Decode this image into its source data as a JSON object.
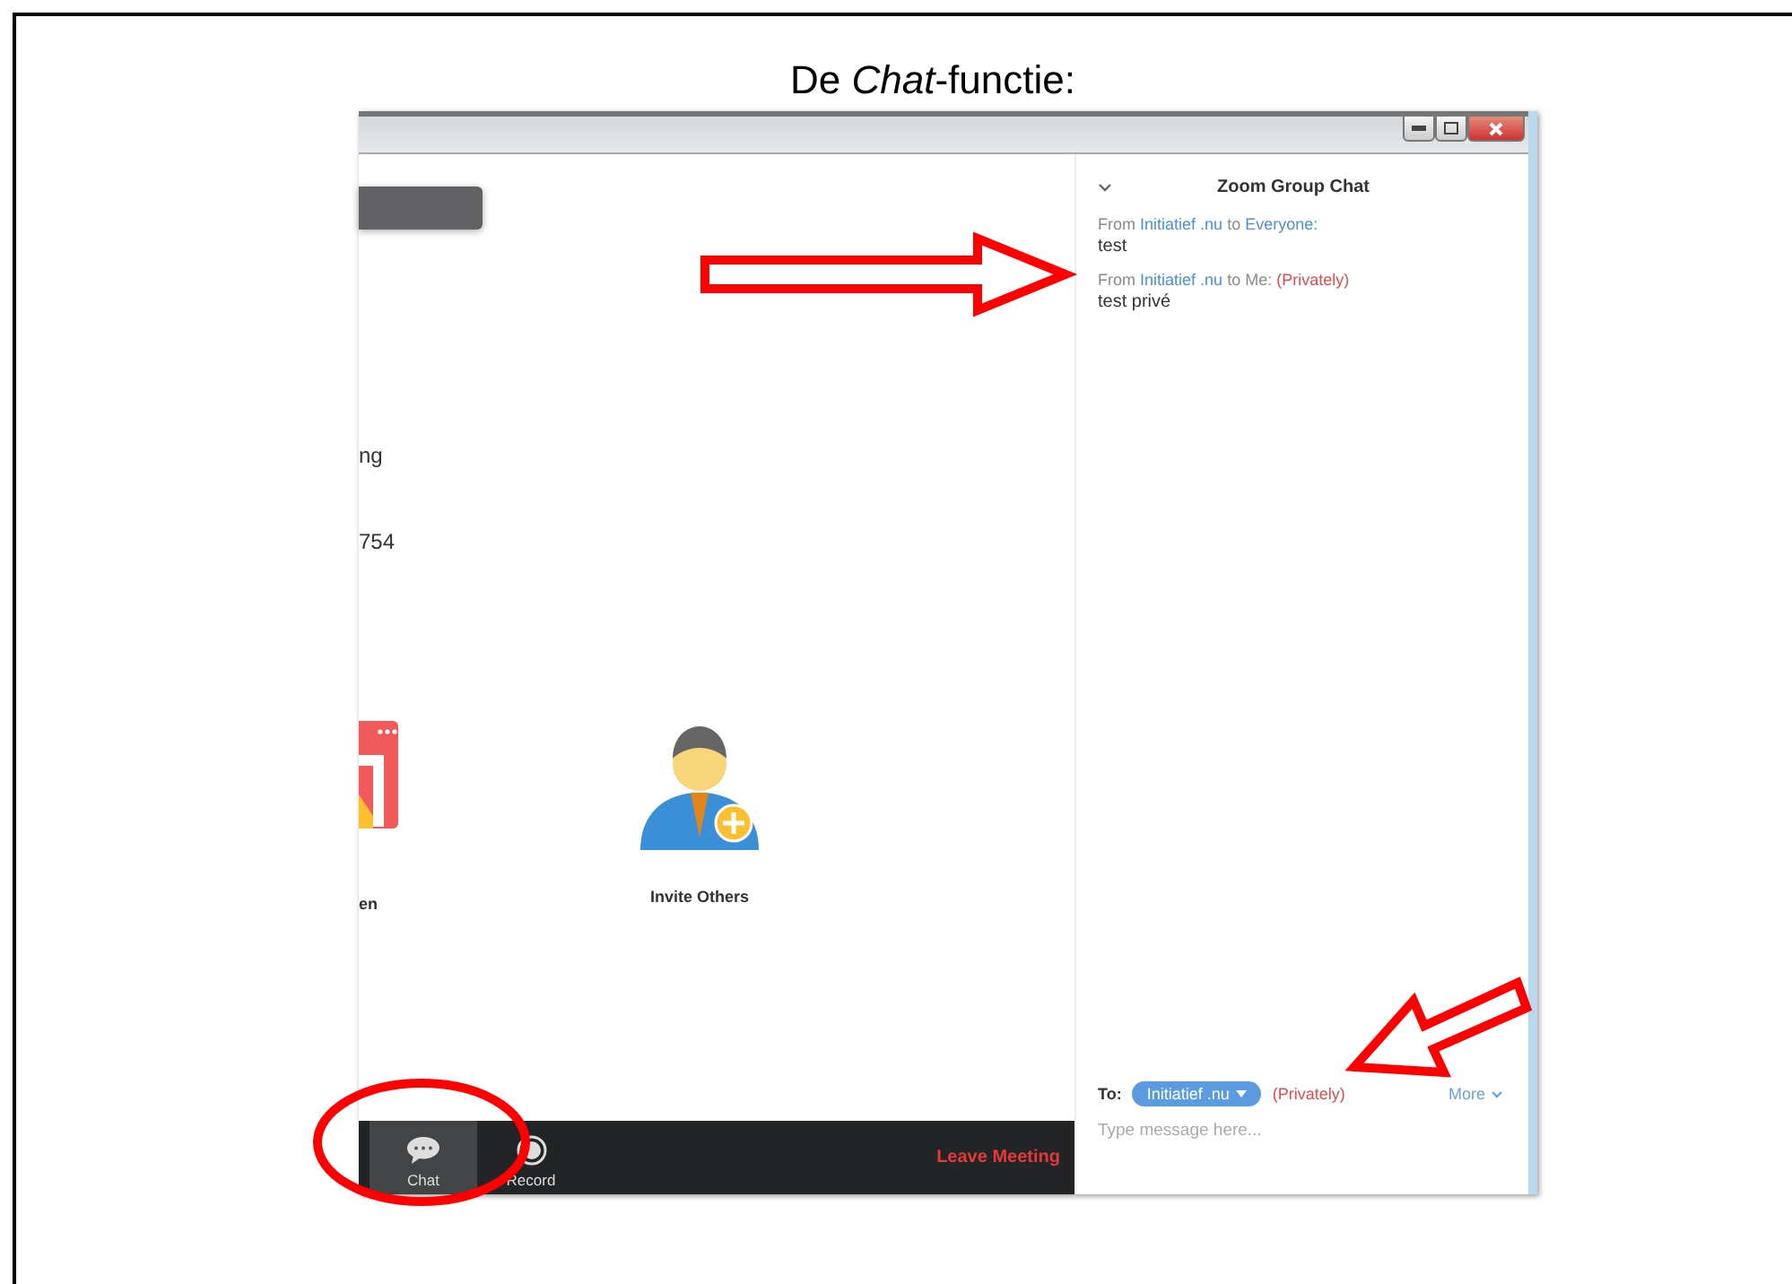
{
  "slide_title": "De *Chat*-functie:",
  "meeting": {
    "cut_texts": [
      "ng",
      "754"
    ],
    "actions": [
      {
        "kind": "screen",
        "label": "en"
      },
      {
        "kind": "invite",
        "label": "Invite Others"
      }
    ],
    "toolbar": [
      {
        "kind": "chat",
        "label": "Chat",
        "selected": true
      },
      {
        "kind": "record",
        "label": "Record",
        "selected": false
      }
    ],
    "leave": "Leave Meeting"
  },
  "chat": {
    "title": "Zoom Group Chat",
    "messages": [
      {
        "from": "From",
        "sender": "Initiatief .nu",
        "to": "to",
        "recipient": "Everyone:",
        "text": "test"
      },
      {
        "from": "From",
        "sender": "Initiatief .nu",
        "to": "to Me:",
        "private_tag": "(Privately)",
        "text": "test privé"
      }
    ],
    "to_label": "To:",
    "recipient": "Initiatief .nu",
    "private_tag": "(Privately)",
    "more": "More",
    "input": {
      "placeholder": "Type message here..."
    }
  }
}
